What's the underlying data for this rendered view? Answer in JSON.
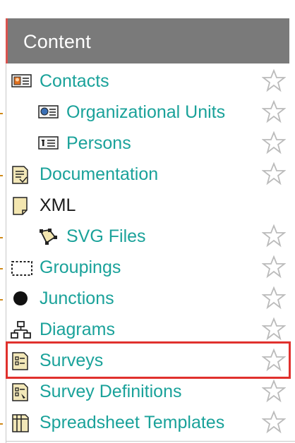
{
  "panel": {
    "title": "Content",
    "items": [
      {
        "label": "Contacts",
        "icon": "contact-card-icon",
        "favorite": true
      },
      {
        "label": "Organizational Units",
        "icon": "org-unit-card-icon",
        "favorite": true
      },
      {
        "label": "Persons",
        "icon": "person-card-icon",
        "favorite": true
      },
      {
        "label": "Documentation",
        "icon": "document-icon",
        "favorite": true
      },
      {
        "label": "XML",
        "icon": "xml-page-icon",
        "favorite": false
      },
      {
        "label": "SVG Files",
        "icon": "svg-file-icon",
        "favorite": true
      },
      {
        "label": "Groupings",
        "icon": "grouping-icon",
        "favorite": true
      },
      {
        "label": "Junctions",
        "icon": "junction-dot-icon",
        "favorite": true
      },
      {
        "label": "Diagrams",
        "icon": "diagram-hierarchy-icon",
        "favorite": true
      },
      {
        "label": "Surveys",
        "icon": "survey-icon",
        "favorite": true
      },
      {
        "label": "Survey Definitions",
        "icon": "survey-definition-icon",
        "favorite": true
      },
      {
        "label": "Spreadsheet Templates",
        "icon": "spreadsheet-template-icon",
        "favorite": true
      }
    ]
  },
  "colors": {
    "header_bg": "#7a7a7a",
    "header_accent": "#d9534f",
    "link_text": "#1aa29a",
    "highlight_border": "#e0312d"
  }
}
